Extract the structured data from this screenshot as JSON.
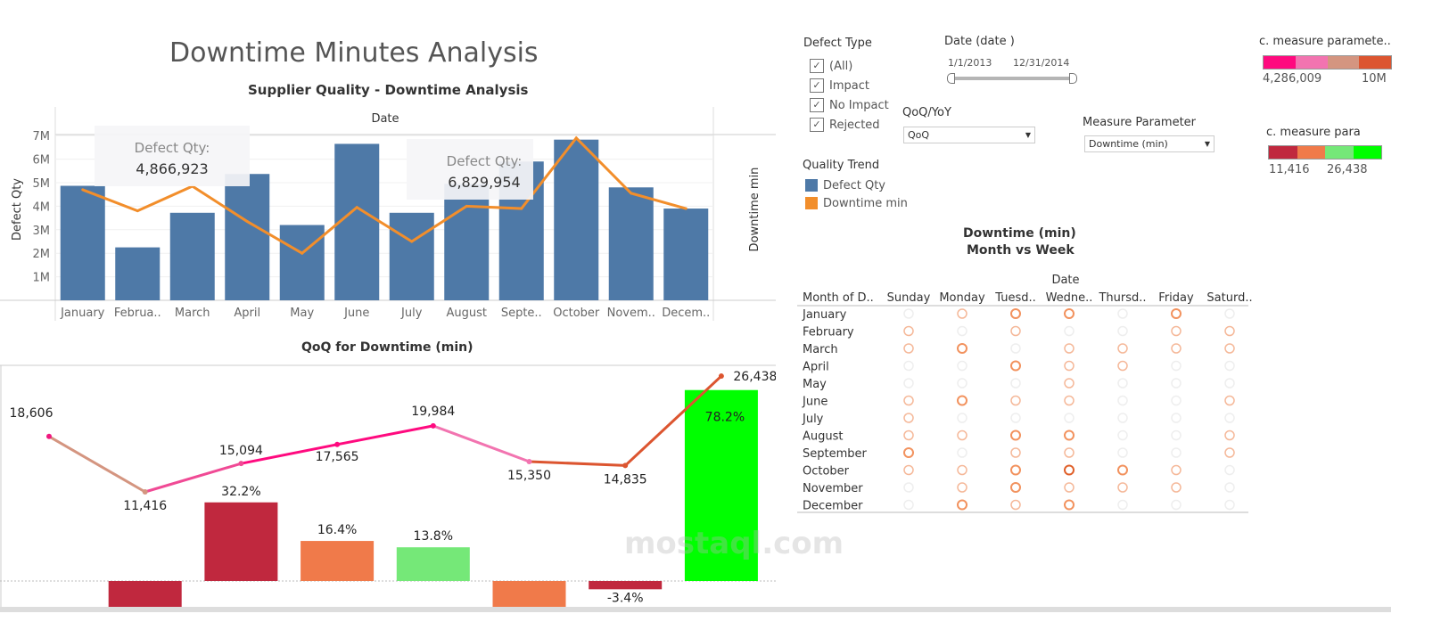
{
  "title": "Downtime Minutes Analysis",
  "top_chart_title": "Supplier Quality  - Downtime Analysis",
  "bottom_chart_title": "QoQ for Downtime (min)",
  "heatmap_title_1": "Downtime (min)",
  "heatmap_title_2": "Month vs Week",
  "filters": {
    "defect_type": {
      "label": "Defect Type",
      "items": [
        "(All)",
        "Impact",
        "No Impact",
        "Rejected"
      ],
      "checked": [
        true,
        true,
        true,
        true
      ]
    },
    "date": {
      "label": "Date (date )",
      "start": "1/1/2013",
      "end": "12/31/2014"
    },
    "qoq": {
      "label": "QoQ/YoY",
      "value": "QoQ"
    },
    "measure": {
      "label": "Measure Parameter",
      "value": "Downtime (min)"
    },
    "quality_trend": {
      "label": "Quality Trend",
      "items": [
        {
          "name": "Defect Qty",
          "color": "#4e79a7"
        },
        {
          "name": "Downtime min",
          "color": "#f28e2b"
        }
      ]
    },
    "ramp1": {
      "label": "c. measure paramete..",
      "min": "4,286,009",
      "max": "10M",
      "colors": [
        "#ff0a7f",
        "#f274b0",
        "#d49580",
        "#dc5530"
      ]
    },
    "ramp2": {
      "label": "c. measure para",
      "min": "11,416",
      "max": "26,438",
      "colors": [
        "#c0283e",
        "#f07a4a",
        "#75e878",
        "#00ff00"
      ]
    }
  },
  "chart_data": [
    {
      "type": "bar",
      "title": "Supplier Quality  - Downtime Analysis",
      "xheader": "Date",
      "ylabel": "Defect Qty",
      "y2label": "Downtime min",
      "categories": [
        "January",
        "Februa..",
        "March",
        "April",
        "May",
        "June",
        "July",
        "August",
        "Septe..",
        "October",
        "Novem..",
        "Decem.."
      ],
      "yticks": [
        "1M",
        "2M",
        "3M",
        "4M",
        "5M",
        "6M",
        "7M"
      ],
      "ylim": [
        0,
        7200000
      ],
      "series": [
        {
          "name": "Defect Qty",
          "type": "bar",
          "color": "#4e79a7",
          "values": [
            4866923,
            2250000,
            3720000,
            5370000,
            3200000,
            6650000,
            3720000,
            4950000,
            5900000,
            6829954,
            4800000,
            3900000
          ]
        },
        {
          "name": "Downtime min",
          "type": "line",
          "color": "#f28e2b",
          "values": [
            4.7,
            3.8,
            4.85,
            3.35,
            2.0,
            3.95,
            2.5,
            4.0,
            3.9,
            6.9,
            4.55,
            3.9
          ]
        }
      ],
      "tooltips": [
        {
          "label": "Defect Qty:",
          "value": "4,866,923"
        },
        {
          "label": "Defect Qty:",
          "value": "6,829,954"
        }
      ]
    },
    {
      "type": "bar",
      "title": "QoQ for Downtime (min)",
      "line_values": [
        18606,
        11416,
        15094,
        17565,
        19984,
        15350,
        14835,
        26438
      ],
      "line_labels": [
        "18,606",
        "11,416",
        "15,094",
        "17,565",
        "19,984",
        "15,350",
        "14,835",
        "26,438"
      ],
      "qoq_pct": [
        null,
        -38.6,
        32.2,
        16.4,
        13.8,
        -23.2,
        -3.4,
        78.2
      ],
      "qoq_labels": [
        "",
        "",
        "32.2%",
        "16.4%",
        "13.8%",
        "",
        "-3.4%",
        "78.2%"
      ],
      "bar_colors": [
        "",
        "#c0283e",
        "#c0283e",
        "#f07a4a",
        "#75e878",
        "#f07a4a",
        "#c0283e",
        "#00ff00"
      ]
    },
    {
      "type": "heatmap",
      "title": "Downtime (min) Month vs Week",
      "col_header": "Date",
      "row_header": "Month of D..",
      "columns": [
        "Sunday",
        "Monday",
        "Tuesd..",
        "Wedne..",
        "Thursd..",
        "Friday",
        "Saturd.."
      ],
      "rows": [
        "January",
        "February",
        "March",
        "April",
        "May",
        "June",
        "July",
        "August",
        "September",
        "October",
        "November",
        "December"
      ],
      "levels": [
        [
          0,
          1,
          2,
          2,
          0,
          2,
          0
        ],
        [
          1,
          0,
          1,
          0,
          0,
          1,
          1
        ],
        [
          1,
          2,
          0,
          1,
          1,
          1,
          1
        ],
        [
          0,
          0,
          2,
          1,
          1,
          0,
          0
        ],
        [
          0,
          0,
          0,
          1,
          0,
          0,
          0
        ],
        [
          1,
          2,
          1,
          1,
          0,
          0,
          1
        ],
        [
          1,
          0,
          0,
          0,
          0,
          0,
          0
        ],
        [
          1,
          1,
          2,
          2,
          0,
          0,
          1
        ],
        [
          2,
          0,
          1,
          1,
          0,
          0,
          1
        ],
        [
          1,
          1,
          2,
          3,
          2,
          1,
          0
        ],
        [
          0,
          1,
          2,
          1,
          1,
          1,
          0
        ],
        [
          0,
          2,
          1,
          2,
          0,
          0,
          0
        ]
      ],
      "level_colors": [
        "#eeeeee",
        "#f5b899",
        "#f2925e",
        "#e0602a"
      ]
    }
  ],
  "watermark": "مستقل mostaql.com"
}
